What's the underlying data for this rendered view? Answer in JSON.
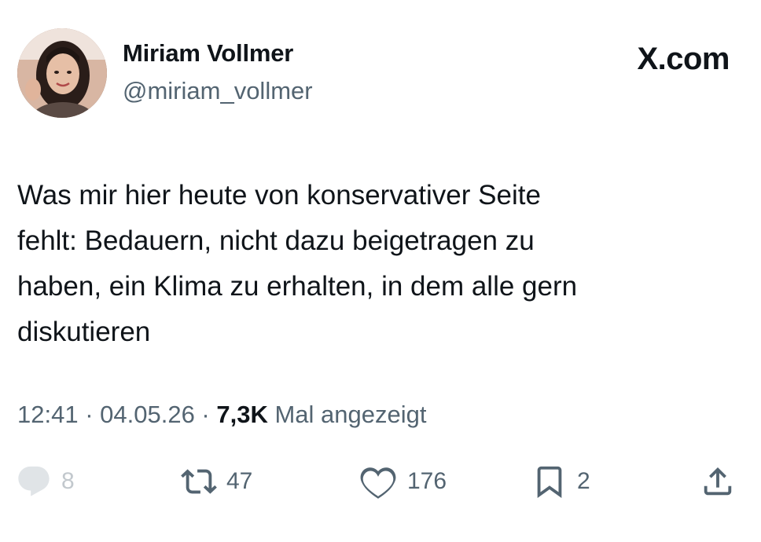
{
  "author": {
    "name": "Miriam Vollmer",
    "handle": "@miriam_vollmer"
  },
  "brand": "X.com",
  "tweet": {
    "lines": [
      "Was mir hier heute von konservativer Seite",
      "fehlt: Bedauern, nicht dazu beigetragen zu",
      "haben, ein Klima zu erhalten, in dem alle gern",
      "diskutieren"
    ]
  },
  "meta": {
    "time": "12:41",
    "sep1": " · ",
    "date": "04.05.26",
    "sep2": " · ",
    "views": "7,3K",
    "views_label": " Mal angezeigt"
  },
  "actions": {
    "replies": "8",
    "reposts": "47",
    "likes": "176",
    "bookmarks": "2"
  },
  "colors": {
    "text": "#0f1419",
    "secondary": "#536471",
    "background": "#ffffff"
  },
  "icons": [
    "reply-icon",
    "repost-icon",
    "like-icon",
    "bookmark-icon",
    "share-icon"
  ]
}
